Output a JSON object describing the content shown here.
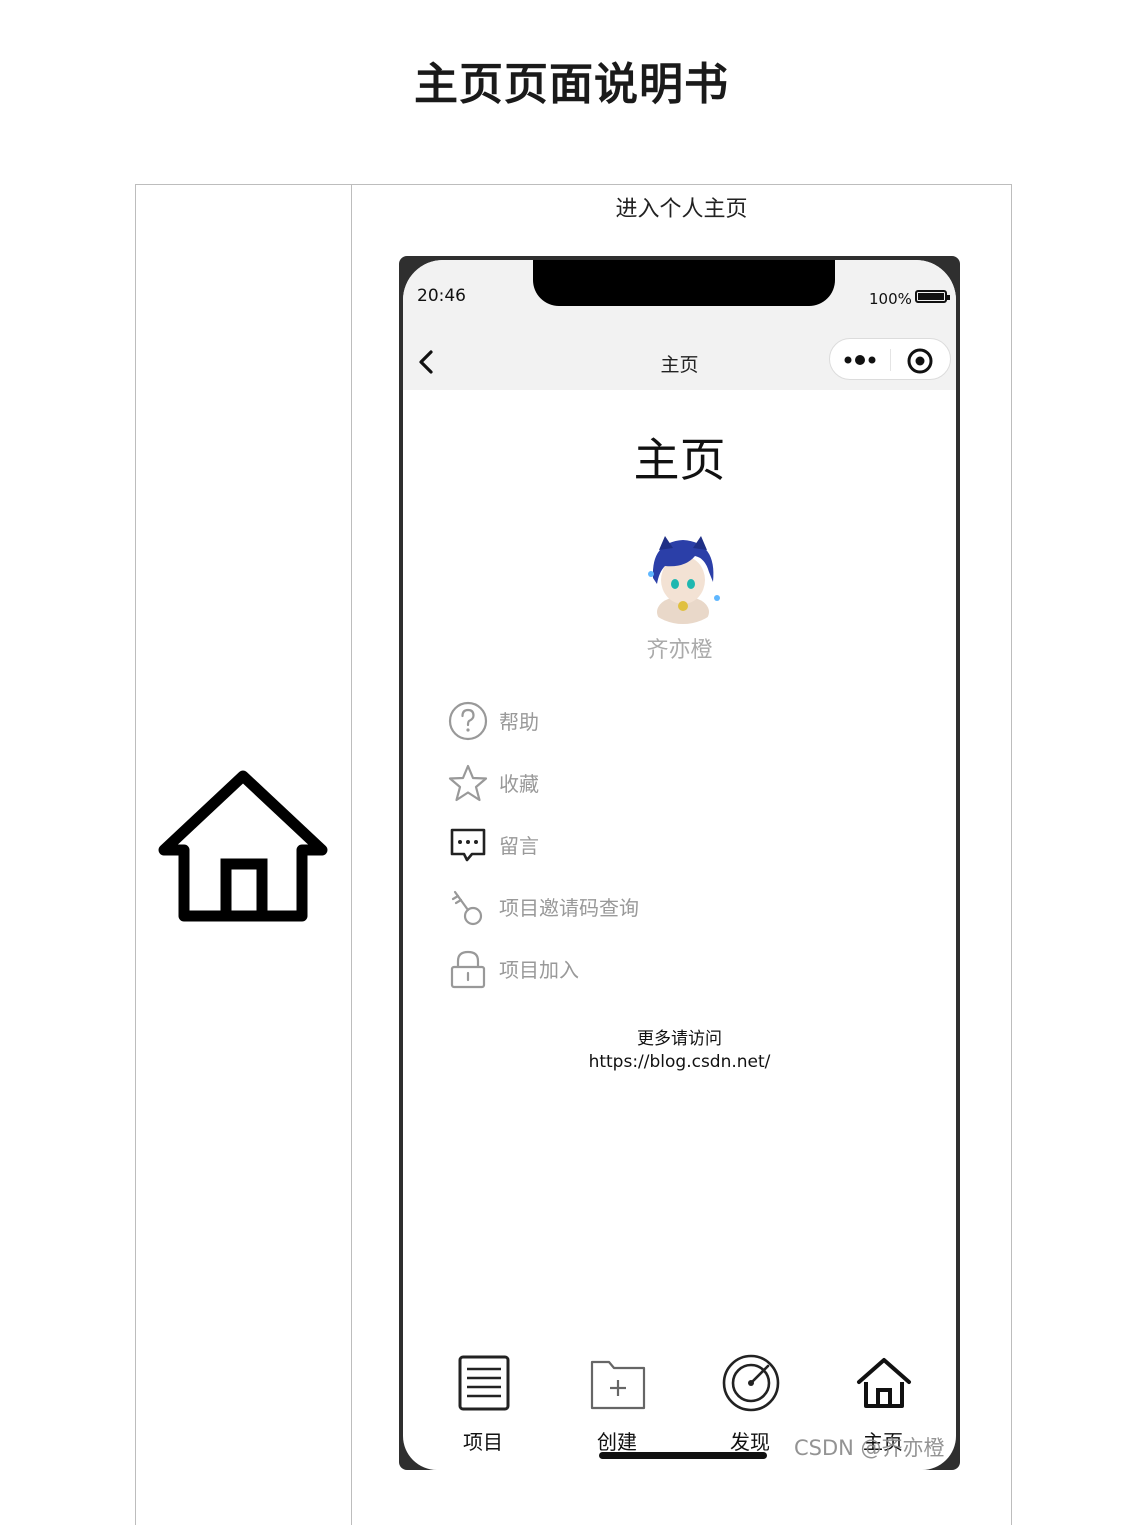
{
  "document": {
    "title": "主页页面说明书",
    "caption": "进入个人主页"
  },
  "phone": {
    "status_bar": {
      "time": "20:46",
      "battery": "100%"
    },
    "nav": {
      "title": "主页",
      "back_icon": "chevron-left-icon",
      "more_icon": "more-dots-icon",
      "close_icon": "target-circle-icon"
    },
    "page": {
      "heading": "主页",
      "username": "齐亦橙",
      "menu": [
        {
          "label": "帮助",
          "icon": "question-icon"
        },
        {
          "label": "收藏",
          "icon": "star-icon"
        },
        {
          "label": "留言",
          "icon": "message-icon"
        },
        {
          "label": "项目邀请码查询",
          "icon": "key-icon"
        },
        {
          "label": "项目加入",
          "icon": "lock-icon"
        }
      ],
      "footer_line1": "更多请访问",
      "footer_line2": "https://blog.csdn.net/"
    },
    "tabbar": [
      {
        "label": "项目",
        "icon": "list-icon"
      },
      {
        "label": "创建",
        "icon": "folder-plus-icon"
      },
      {
        "label": "发现",
        "icon": "compass-icon"
      },
      {
        "label": "主页",
        "icon": "home-icon"
      }
    ]
  },
  "watermark": "CSDN @齐亦橙"
}
